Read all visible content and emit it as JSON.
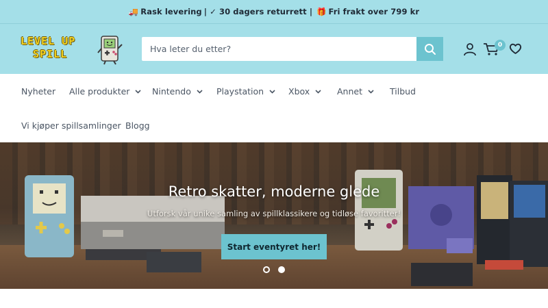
{
  "announcement": {
    "part1": "Rask levering",
    "part2": "| ✓ 30 dagers returrett |",
    "part3": "Fri frakt over 799 kr"
  },
  "logo": {
    "line1": "LEVEL UP",
    "line2": "SPILL"
  },
  "search": {
    "placeholder": "Hva leter du etter?"
  },
  "cart": {
    "count": "0"
  },
  "nav": {
    "items": [
      {
        "label": "Nyheter"
      },
      {
        "label": "Alle produkter"
      },
      {
        "label": "Nintendo"
      },
      {
        "label": "Playstation"
      },
      {
        "label": "Xbox"
      },
      {
        "label": "Annet"
      },
      {
        "label": "Tilbud"
      },
      {
        "label": "Vi kjøper spillsamlinger"
      },
      {
        "label": "Blogg"
      }
    ]
  },
  "hero": {
    "title": "Retro skatter, moderne glede",
    "subtitle": "Utforsk vår unike samling av spillklassikere og tidløse favoritter!",
    "cta": "Start eventyret her!"
  },
  "colors": {
    "accent": "#6cc3cf",
    "header_bg": "#a4dfe8"
  },
  "icons": [
    "truck-icon",
    "check-icon",
    "gift-icon",
    "search-icon",
    "user-icon",
    "cart-icon",
    "heart-icon",
    "chevron-down-icon"
  ]
}
